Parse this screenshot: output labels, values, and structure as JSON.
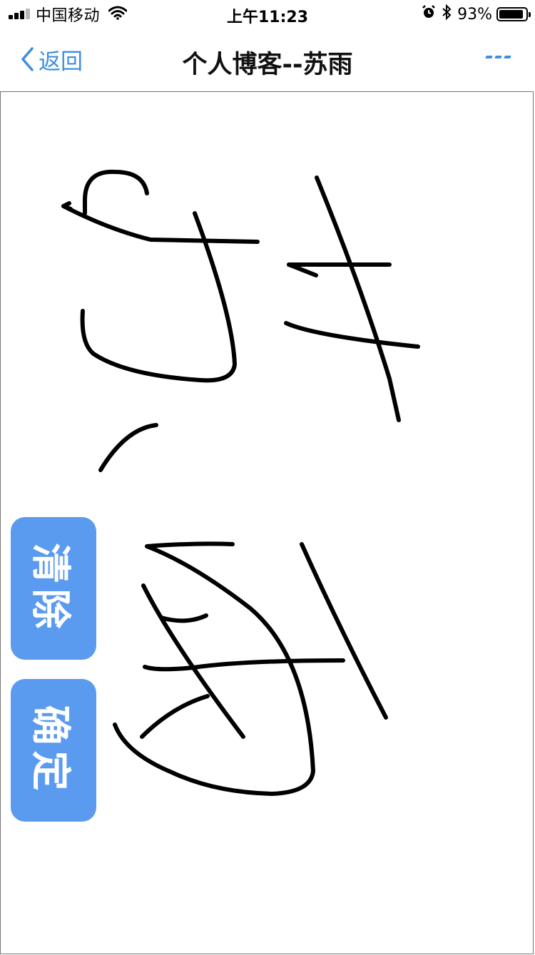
{
  "status_bar": {
    "carrier": "中国移动",
    "time": "上午11:23",
    "battery_percent": "93%",
    "battery_level": 0.93,
    "signal_bars": 3,
    "icons": [
      "wifi-icon",
      "alarm-icon",
      "bluetooth-icon",
      "battery-icon"
    ]
  },
  "nav": {
    "back_label": "返回",
    "title": "个人博客--苏雨",
    "more_icon": "more-icon"
  },
  "canvas": {
    "content": "handwritten-signature"
  },
  "buttons": {
    "clear_label": "清除",
    "confirm_label": "确定"
  },
  "colors": {
    "accent": "#3d8fe0",
    "button_bg": "#5a9bef",
    "stroke": "#000000",
    "canvas_border": "#777777"
  }
}
